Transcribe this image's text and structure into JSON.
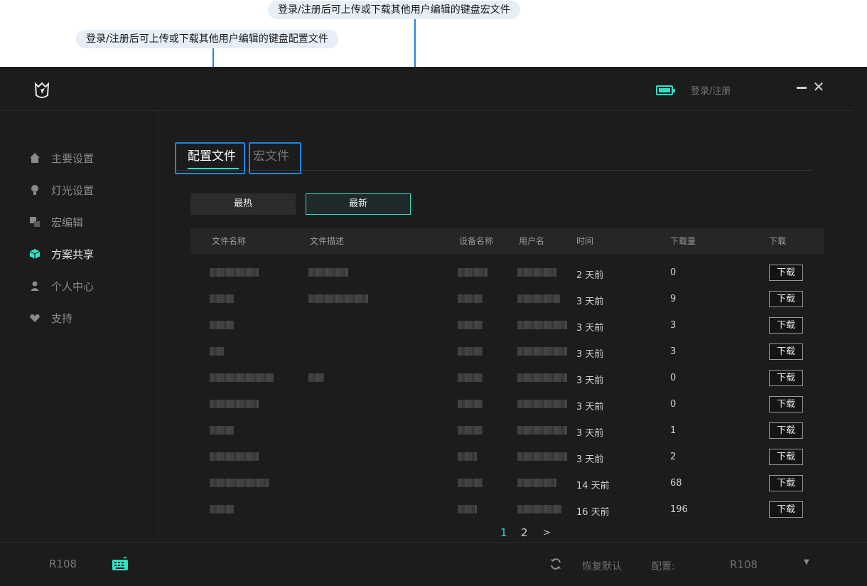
{
  "callouts": {
    "macro": "登录/注册后可上传或下载其他用户编辑的键盘宏文件",
    "config": "登录/注册后可上传或下载其他用户编辑的键盘配置文件"
  },
  "header": {
    "login": "登录/注册"
  },
  "sidebar": {
    "items": [
      {
        "label": "主要设置",
        "icon": "home-icon"
      },
      {
        "label": "灯光设置",
        "icon": "bulb-icon"
      },
      {
        "label": "宏编辑",
        "icon": "macro-icon"
      },
      {
        "label": "方案共享",
        "icon": "cube-icon",
        "active": true
      },
      {
        "label": "个人中心",
        "icon": "user-icon"
      },
      {
        "label": "支持",
        "icon": "heart-icon"
      }
    ]
  },
  "tabs": {
    "config": "配置文件",
    "macro": "宏文件"
  },
  "sort": {
    "hot": "最热",
    "new": "最新"
  },
  "table": {
    "headers": [
      "文件名称",
      "文件描述",
      "设备名称",
      "用户名",
      "时间",
      "下载量",
      "下载"
    ],
    "rows": [
      {
        "time": "2 天前",
        "count": "0",
        "download": "下载"
      },
      {
        "time": "3 天前",
        "count": "9",
        "download": "下载"
      },
      {
        "time": "3 天前",
        "count": "3",
        "download": "下载"
      },
      {
        "time": "3 天前",
        "count": "3",
        "download": "下载"
      },
      {
        "time": "3 天前",
        "count": "0",
        "download": "下载"
      },
      {
        "time": "3 天前",
        "count": "0",
        "download": "下载"
      },
      {
        "time": "3 天前",
        "count": "1",
        "download": "下载"
      },
      {
        "time": "3 天前",
        "count": "2",
        "download": "下载"
      },
      {
        "time": "14 天前",
        "count": "68",
        "download": "下载"
      },
      {
        "time": "16 天前",
        "count": "196",
        "download": "下载"
      }
    ]
  },
  "pager": {
    "p1": "1",
    "p2": "2",
    "next": ">"
  },
  "footer": {
    "device": "R108",
    "restore": "恢复默认",
    "config_label": "配置:",
    "config_value": "R108"
  },
  "colors": {
    "accent": "#2ee0c4",
    "annotation": "#1e86e0",
    "background": "#1c1c1c"
  }
}
